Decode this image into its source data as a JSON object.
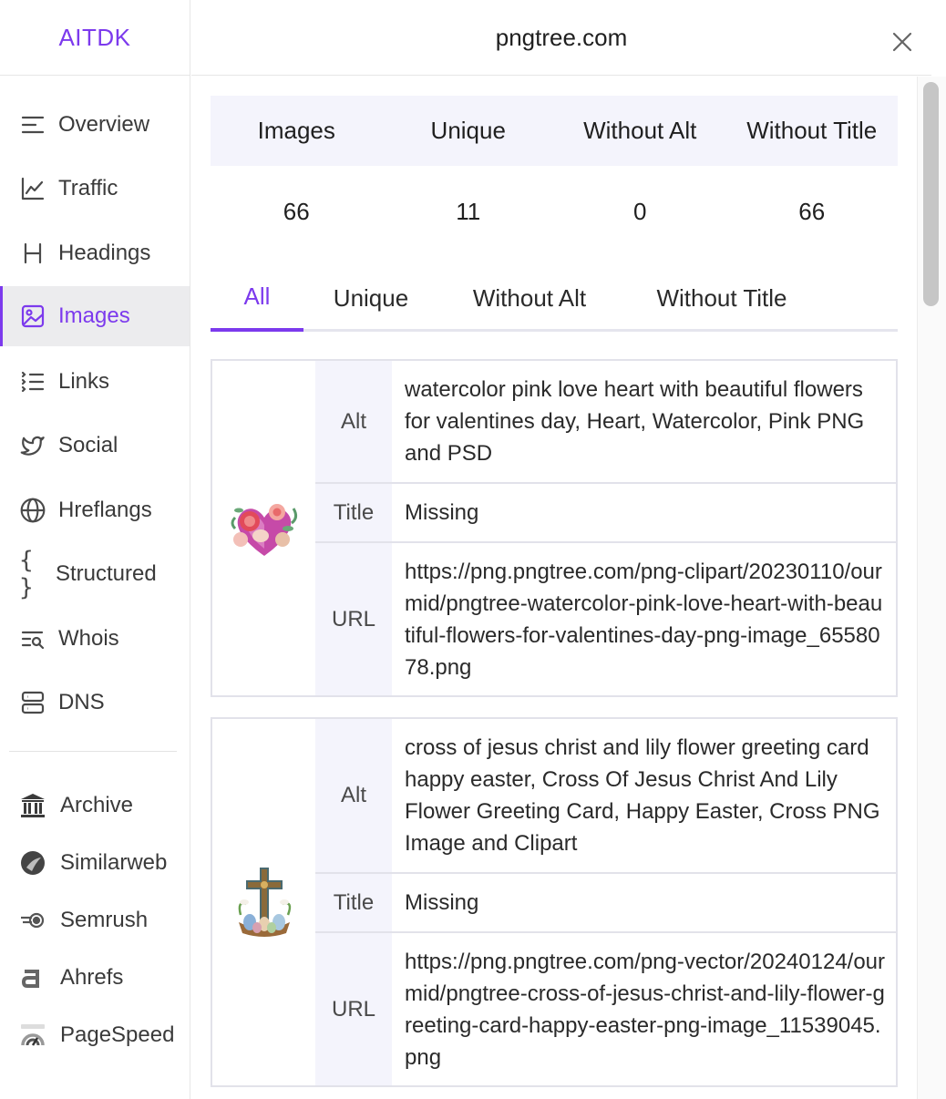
{
  "brand": "AITDK",
  "header": {
    "domain": "pngtree.com"
  },
  "sidebar": {
    "items": [
      {
        "label": "Overview",
        "icon": "list-icon"
      },
      {
        "label": "Traffic",
        "icon": "line-chart-icon"
      },
      {
        "label": "Headings",
        "icon": "heading-icon"
      },
      {
        "label": "Images",
        "icon": "image-icon"
      },
      {
        "label": "Links",
        "icon": "numbered-list-icon"
      },
      {
        "label": "Social",
        "icon": "twitter-icon"
      },
      {
        "label": "Hreflangs",
        "icon": "globe-icon"
      },
      {
        "label": "Structured",
        "icon": "braces-icon"
      },
      {
        "label": "Whois",
        "icon": "search-list-icon"
      },
      {
        "label": "DNS",
        "icon": "server-icon"
      }
    ],
    "tools": [
      {
        "label": "Archive",
        "icon": "archive-icon"
      },
      {
        "label": "Similarweb",
        "icon": "similarweb-icon"
      },
      {
        "label": "Semrush",
        "icon": "semrush-icon"
      },
      {
        "label": "Ahrefs",
        "icon": "ahrefs-icon"
      },
      {
        "label": "PageSpeed",
        "icon": "pagespeed-icon"
      }
    ]
  },
  "stats": {
    "headers": [
      "Images",
      "Unique",
      "Without Alt",
      "Without Title"
    ],
    "values": [
      "66",
      "11",
      "0",
      "66"
    ]
  },
  "tabs": [
    "All",
    "Unique",
    "Without Alt",
    "Without Title"
  ],
  "labels": {
    "alt": "Alt",
    "title": "Title",
    "url": "URL"
  },
  "images": [
    {
      "alt": "watercolor pink love heart with beautiful flowers for valentines day, Heart, Watercolor, Pink PNG and PSD",
      "title": "Missing",
      "url": "https://png.pngtree.com/png-clipart/20230110/ourmid/pngtree-watercolor-pink-love-heart-with-beautiful-flowers-for-valentines-day-png-image_6558078.png"
    },
    {
      "alt": "cross of jesus christ and lily flower greeting card happy easter, Cross Of Jesus Christ And Lily Flower Greeting Card, Happy Easter, Cross PNG Image and Clipart",
      "title": "Missing",
      "url": "https://png.pngtree.com/png-vector/20240124/ourmid/pngtree-cross-of-jesus-christ-and-lily-flower-greeting-card-happy-easter-png-image_11539045.png"
    }
  ],
  "colors": {
    "accent": "#7c3aed"
  }
}
